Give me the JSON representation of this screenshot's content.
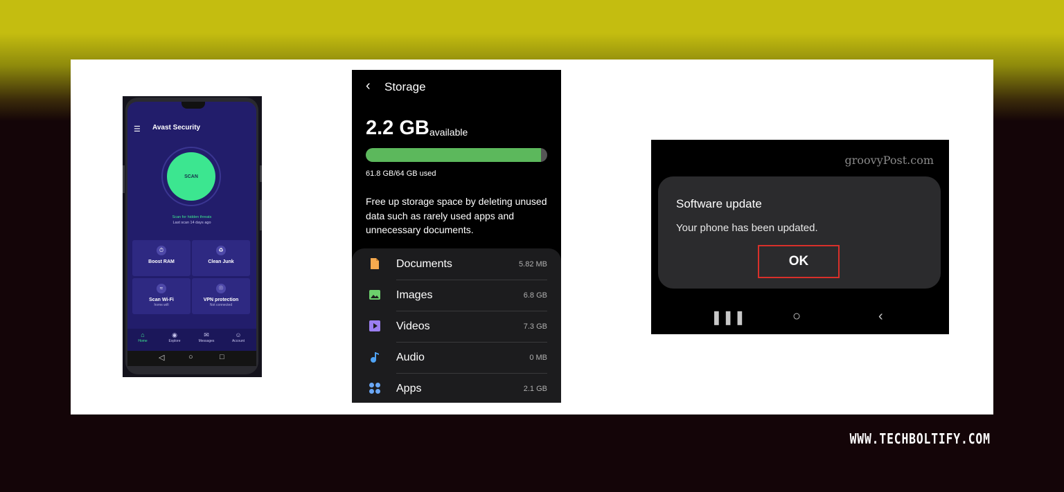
{
  "watermark": "WWW.TECHBOLTIFY.COM",
  "avast": {
    "app_title": "Avast Security",
    "scan_label": "SCAN",
    "scan_hint": "Scan for hidden threats",
    "last_scan": "Last scan 14 days ago",
    "tiles": [
      {
        "label": "Boost RAM",
        "sub": ""
      },
      {
        "label": "Clean Junk",
        "sub": ""
      },
      {
        "label": "Scan Wi-Fi",
        "sub": "home.wifi"
      },
      {
        "label": "VPN protection",
        "sub": "Not connected"
      }
    ],
    "nav": [
      {
        "label": "Home"
      },
      {
        "label": "Explore"
      },
      {
        "label": "Messages"
      },
      {
        "label": "Account"
      }
    ]
  },
  "storage": {
    "title": "Storage",
    "available_value": "2.2 GB",
    "available_label": "available",
    "used_fraction": 0.966,
    "used_text": "61.8 GB/64 GB used",
    "description": "Free up storage space by deleting unused data such as rarely used apps and unnecessary documents.",
    "colors": {
      "bar_fill": "#5cb85c"
    },
    "items": [
      {
        "name": "Documents",
        "size": "5.82 MB",
        "icon": "document-icon",
        "color": "#f5a94f"
      },
      {
        "name": "Images",
        "size": "6.8 GB",
        "icon": "image-icon",
        "color": "#6ccf6c"
      },
      {
        "name": "Videos",
        "size": "7.3 GB",
        "icon": "video-icon",
        "color": "#9b7ef0"
      },
      {
        "name": "Audio",
        "size": "0 MB",
        "icon": "music-note-icon",
        "color": "#4fa3f5"
      },
      {
        "name": "Apps",
        "size": "2.1 GB",
        "icon": "apps-grid-icon",
        "color": "#6aa7f5"
      }
    ]
  },
  "update": {
    "source": "groovyPost.com",
    "title": "Software update",
    "message": "Your phone has been updated.",
    "ok_label": "OK",
    "colors": {
      "highlight": "#d9302a"
    }
  }
}
